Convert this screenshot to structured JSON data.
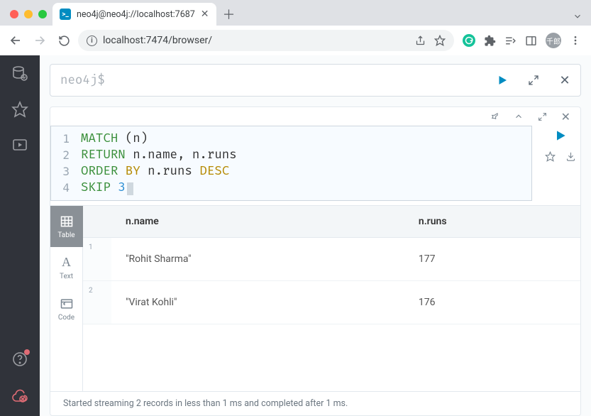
{
  "browser": {
    "tab_title": "neo4j@neo4j://localhost:7687",
    "url": "localhost:7474/browser/",
    "avatar_text": "千郎"
  },
  "command_bar": {
    "prompt": "neo4j$",
    "value": ""
  },
  "editor": {
    "lines": [
      "1",
      "2",
      "3",
      "4"
    ],
    "code": {
      "l1_match": "MATCH",
      "l1_rest": " (n)",
      "l2_return": "RETURN",
      "l2_rest": " n.name, n.runs",
      "l3_order": "ORDER",
      "l3_by": " BY",
      "l3_rest": " n.runs ",
      "l3_desc": "DESC",
      "l4_skip": "SKIP",
      "l4_num": " 3"
    }
  },
  "view_tabs": {
    "table": "Table",
    "text": "Text",
    "code": "Code"
  },
  "table": {
    "headers": {
      "c1": "n.name",
      "c2": "n.runs"
    },
    "rows": [
      {
        "idx": "1",
        "name": "\"Rohit Sharma\"",
        "runs": "177"
      },
      {
        "idx": "2",
        "name": "\"Virat Kohli\"",
        "runs": "176"
      }
    ]
  },
  "status": "Started streaming 2 records in less than 1 ms and completed after 1 ms."
}
